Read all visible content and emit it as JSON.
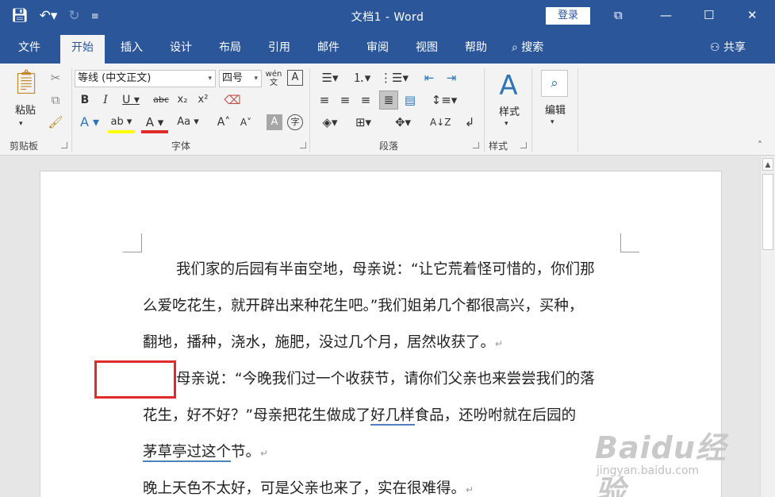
{
  "titlebar": {
    "title": "文档1 - Word",
    "login": "登录",
    "qat": {
      "save_icon": "save-icon",
      "undo_icon": "undo-icon",
      "redo_icon": "redo-icon",
      "customize_icon": "customize-icon"
    },
    "controls": {
      "ribbon_display": "⧉",
      "minimize": "—",
      "maximize": "☐",
      "close": "✕"
    }
  },
  "tabs": [
    "文件",
    "开始",
    "插入",
    "设计",
    "布局",
    "引用",
    "邮件",
    "审阅",
    "视图",
    "帮助"
  ],
  "active_tab": "开始",
  "search_label": "搜索",
  "share_label": "共享",
  "ribbon": {
    "clipboard": {
      "label": "剪贴板",
      "paste_label": "粘贴"
    },
    "font": {
      "label": "字体",
      "font_name": "等线 (中文正文)",
      "font_size": "四号",
      "pinyin_icon": "wén"
    },
    "paragraph": {
      "label": "段落"
    },
    "styles": {
      "label": "样式",
      "styles_label": "样式"
    },
    "editing": {
      "editing_label": "编辑"
    }
  },
  "document": {
    "lines": [
      "我们家的后园有半亩空地，母亲说：“让它荒着怪可惜的，你们那",
      "么爱吃花生，就开辟出来种花生吧。”我们姐弟几个都很高兴，买种，",
      "翻地，播种，浇水，施肥，没过几个月，居然收获了。",
      "母亲说：“今晚我们过一个收获节，请你们父亲也来尝尝我们的落",
      "花生，好不好？”母亲把花生做成了",
      "好几样",
      "食品，还吩咐就在后园的",
      "茅草亭过这个",
      "节。",
      "晚上天色不太好，可是父亲也来了，实在很难得。"
    ],
    "para_mark": "↵"
  },
  "watermark": {
    "brand": "Baidu经验",
    "url": "jingyan.baidu.com"
  },
  "colors": {
    "accent": "#2b579a",
    "highlight_box": "#e02b2b",
    "underline": "#4f81bd"
  }
}
